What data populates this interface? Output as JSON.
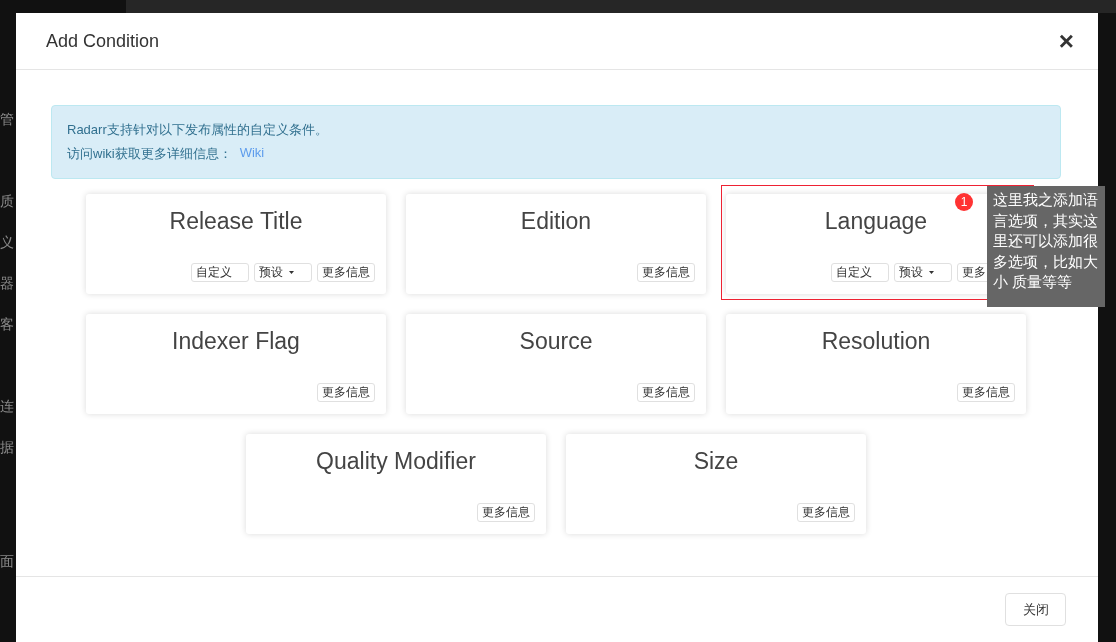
{
  "background_sidebar": [
    "管",
    "质",
    "义",
    "器",
    "客",
    "连",
    "据",
    "面"
  ],
  "modal": {
    "title": "Add Condition",
    "close_icon": "×",
    "alert": {
      "line_1": "Radarr支持针对以下发布属性的自定义条件。",
      "line_2": "访问wiki获取更多详细信息：",
      "link": "Wiki"
    },
    "cards": [
      {
        "title": "Release Title",
        "buttons": [
          {
            "kind": "plain",
            "label": "自定义"
          },
          {
            "kind": "dropdown",
            "label": "预设"
          },
          {
            "kind": "plain",
            "label": "更多信息"
          }
        ]
      },
      {
        "title": "Edition",
        "buttons": [
          {
            "kind": "plain",
            "label": "更多信息"
          }
        ]
      },
      {
        "title": "Language",
        "buttons": [
          {
            "kind": "plain",
            "label": "自定义"
          },
          {
            "kind": "dropdown",
            "label": "预设"
          },
          {
            "kind": "plain",
            "label": "更多"
          }
        ]
      },
      {
        "title": "Indexer Flag",
        "buttons": [
          {
            "kind": "plain",
            "label": "更多信息"
          }
        ]
      },
      {
        "title": "Source",
        "buttons": [
          {
            "kind": "plain",
            "label": "更多信息"
          }
        ]
      },
      {
        "title": "Resolution",
        "buttons": [
          {
            "kind": "plain",
            "label": "更多信息"
          }
        ]
      },
      {
        "title": "Quality Modifier",
        "buttons": [
          {
            "kind": "plain",
            "label": "更多信息"
          }
        ]
      },
      {
        "title": "Size",
        "buttons": [
          {
            "kind": "plain",
            "label": "更多信息"
          }
        ]
      }
    ],
    "footer_button": "关闭"
  },
  "annotation": {
    "badge": "1",
    "note": "这里我之添加语言选项，其实这里还可以添加很多选项，比如大小 质量等等"
  }
}
